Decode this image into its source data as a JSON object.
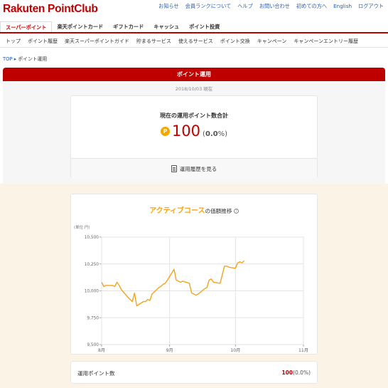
{
  "header": {
    "logo": "Rakuten PointClub",
    "links": [
      "お知らせ",
      "会員ランクについて",
      "ヘルプ",
      "お問い合わせ",
      "初めての方へ",
      "English",
      "ログアウト"
    ]
  },
  "main_tabs": [
    "スーパーポイント",
    "楽天ポイントカード",
    "ギフトカード",
    "キャッシュ",
    "ポイント投資"
  ],
  "sub_nav": [
    "トップ",
    "ポイント履歴",
    "楽天スーパーポイントガイド",
    "貯まるサービス",
    "使えるサービス",
    "ポイント交換",
    "キャンペーン",
    "キャンペーンエントリー履歴"
  ],
  "breadcrumb": {
    "top": "TOP",
    "current": "ポイント運用"
  },
  "section": {
    "title": "ポイント運用",
    "as_of": "2018/10/03 現在",
    "total_title": "現在の運用ポイント数合計",
    "coin": "P",
    "points": "100",
    "pct_open": "(",
    "pct": "0.0",
    "pct_close": "%)",
    "history_link": "運用履歴を見る"
  },
  "chart_section": {
    "title_course": "アクティブコース",
    "title_rest": "の価額推移",
    "help": "?"
  },
  "summary": {
    "label": "運用ポイント数",
    "value": "100",
    "pct": "(0.0%)"
  },
  "colors": {
    "brand": "#bf0000",
    "accent": "#f7a21b"
  },
  "chart_data": {
    "type": "line",
    "unit_label": "(単位:円)",
    "ylim": [
      9500,
      10500
    ],
    "yticks": [
      9500,
      9750,
      10000,
      10250,
      10500
    ],
    "ytick_labels": [
      "9,500",
      "9,750",
      "10,000",
      "10,250",
      "10,500"
    ],
    "xlim": [
      "2018-08-01",
      "2018-11-01"
    ],
    "xtick_labels": [
      "8月",
      "9月",
      "10月",
      "11月"
    ],
    "x_year_label": "2018 年",
    "grid": true,
    "series": [
      {
        "values": [
          [
            "2018-08-01",
            10080
          ],
          [
            "2018-08-02",
            10040
          ],
          [
            "2018-08-03",
            10050
          ],
          [
            "2018-08-06",
            10050
          ],
          [
            "2018-08-07",
            10040
          ],
          [
            "2018-08-08",
            10080
          ],
          [
            "2018-08-09",
            10050
          ],
          [
            "2018-08-10",
            10010
          ],
          [
            "2018-08-13",
            9940
          ],
          [
            "2018-08-14",
            9920
          ],
          [
            "2018-08-15",
            9900
          ],
          [
            "2018-08-16",
            9980
          ],
          [
            "2018-08-17",
            9860
          ],
          [
            "2018-08-20",
            9900
          ],
          [
            "2018-08-21",
            9900
          ],
          [
            "2018-08-22",
            9920
          ],
          [
            "2018-08-23",
            9910
          ],
          [
            "2018-08-24",
            9970
          ],
          [
            "2018-08-27",
            10030
          ],
          [
            "2018-08-28",
            10040
          ],
          [
            "2018-08-29",
            10060
          ],
          [
            "2018-08-30",
            10070
          ],
          [
            "2018-08-31",
            10100
          ],
          [
            "2018-09-03",
            10200
          ],
          [
            "2018-09-04",
            10100
          ],
          [
            "2018-09-05",
            10090
          ],
          [
            "2018-09-06",
            10080
          ],
          [
            "2018-09-07",
            10090
          ],
          [
            "2018-09-10",
            10070
          ],
          [
            "2018-09-11",
            9980
          ],
          [
            "2018-09-12",
            9970
          ],
          [
            "2018-09-13",
            9960
          ],
          [
            "2018-09-14",
            9970
          ],
          [
            "2018-09-17",
            10020
          ],
          [
            "2018-09-18",
            10030
          ],
          [
            "2018-09-19",
            10100
          ],
          [
            "2018-09-20",
            10110
          ],
          [
            "2018-09-21",
            10080
          ],
          [
            "2018-09-24",
            10070
          ],
          [
            "2018-09-25",
            10150
          ],
          [
            "2018-09-26",
            10230
          ],
          [
            "2018-09-27",
            10230
          ],
          [
            "2018-09-28",
            10220
          ],
          [
            "2018-10-01",
            10210
          ],
          [
            "2018-10-02",
            10260
          ],
          [
            "2018-10-03",
            10270
          ],
          [
            "2018-10-04",
            10260
          ],
          [
            "2018-10-05",
            10280
          ]
        ]
      }
    ]
  }
}
